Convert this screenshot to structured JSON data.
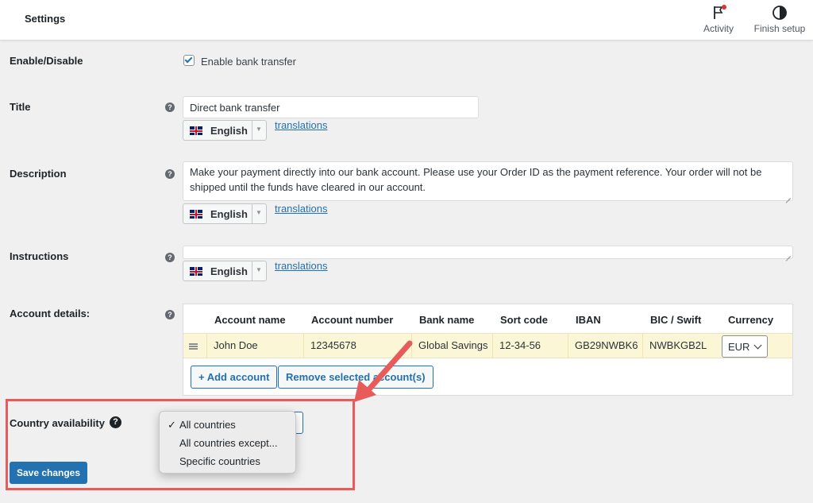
{
  "header": {
    "title": "Settings",
    "activity_label": "Activity",
    "finish_label": "Finish setup",
    "activity_icon": "flag-icon",
    "finish_icon": "half-circle-icon"
  },
  "enable": {
    "label": "Enable/Disable",
    "checkbox_label": "Enable bank transfer",
    "checked": true
  },
  "title_field": {
    "label": "Title",
    "value": "Direct bank transfer",
    "lang": "English",
    "link": "translations"
  },
  "description": {
    "label": "Description",
    "value": "Make your payment directly into our bank account. Please use your Order ID as the payment reference. Your order will not be shipped until the funds have cleared in our account.",
    "lang": "English",
    "link": "translations"
  },
  "instructions": {
    "label": "Instructions",
    "value": "",
    "lang": "English",
    "link": "translations"
  },
  "accounts": {
    "label": "Account details:",
    "headers": [
      "Account name",
      "Account number",
      "Bank name",
      "Sort code",
      "IBAN",
      "BIC / Swift",
      "Currency"
    ],
    "rows": [
      {
        "account_name": "John Doe",
        "account_number": "12345678",
        "bank_name": "Global Savings",
        "sort_code": "12-34-56",
        "iban": "GB29NWBK6",
        "bic": "NWBKGB2L",
        "currency": "EUR"
      }
    ],
    "add_label": "+ Add account",
    "remove_label": "Remove selected account(s)"
  },
  "country": {
    "label": "Country availability",
    "options": [
      "All countries",
      "All countries except...",
      "Specific countries"
    ],
    "selected": "All countries"
  },
  "save_label": "Save changes",
  "colors": {
    "accent": "#2271b1",
    "annotation": "#e85b5b",
    "row_highlight": "#fbf7d6"
  }
}
